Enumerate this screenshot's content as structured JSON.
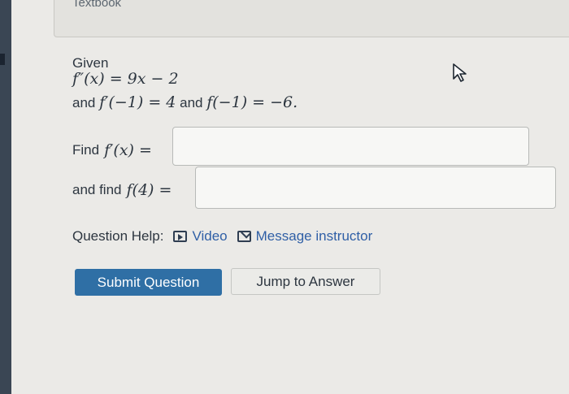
{
  "header": {
    "tab_label": "Textbook"
  },
  "problem": {
    "given_label": "Given",
    "equation": "f″(x) = 9x − 2",
    "condition_prefix": "and",
    "condition_1": "f′(−1) = 4",
    "condition_joiner": "and",
    "condition_2": "f(−1) = −6."
  },
  "questions": [
    {
      "label": "Find",
      "expr": "f′(x) =",
      "value": ""
    },
    {
      "label": "and find",
      "expr": "f(4) =",
      "value": ""
    }
  ],
  "help": {
    "label": "Question Help:",
    "video_label": "Video",
    "video_icon": "play-icon",
    "message_label": "Message instructor",
    "message_icon": "mail-icon"
  },
  "actions": {
    "submit_label": "Submit Question",
    "jump_label": "Jump to Answer"
  },
  "colors": {
    "submit_bg": "#2f6fa5",
    "link": "#2f5fa6"
  }
}
